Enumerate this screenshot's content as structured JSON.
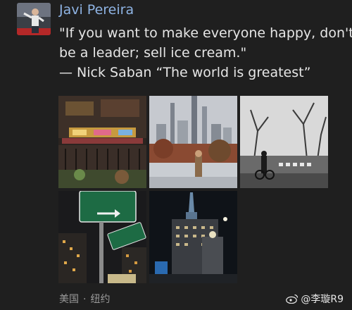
{
  "post": {
    "author_name": "Javi Pereira",
    "text_line_1": "\"If you want to make everyone happy, don't",
    "text_line_2": "be a leader; sell ice cream.\"",
    "text_line_3": "— Nick Saban “The world is greatest”"
  },
  "photos": [
    {
      "icon": "christmas-market-photo"
    },
    {
      "icon": "central-park-skyline-photo"
    },
    {
      "icon": "park-path-cyclist-photo"
    },
    {
      "icon": "broadway-street-sign-photo"
    },
    {
      "icon": "night-tower-building-photo"
    }
  ],
  "footer": {
    "location_country": "美国",
    "separator": "·",
    "location_city": "纽约"
  },
  "watermark": {
    "icon": "weibo-icon",
    "handle": "@李璇R9"
  },
  "colors": {
    "background": "#1f1f1f",
    "author": "#8fb4e4",
    "text": "#e6e6e6",
    "meta": "#9a9a9a"
  }
}
